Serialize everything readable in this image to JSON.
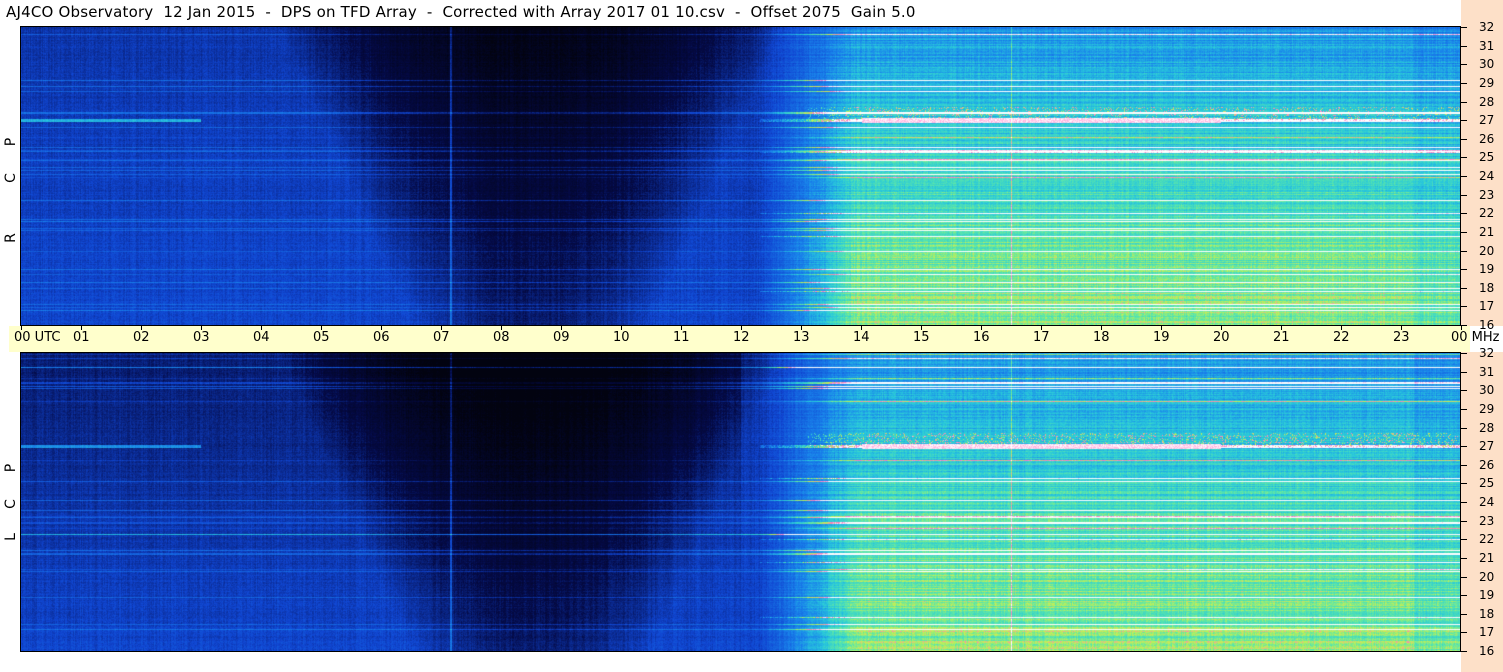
{
  "title": "AJ4CO Observatory  12 Jan 2015  -  DPS on TFD Array  -  Corrected with Array 2017 01 10.csv  -  Offset 2075  Gain 5.0",
  "chart_data": {
    "type": "heatmap",
    "title": "AJ4CO Observatory  12 Jan 2015  -  DPS on TFD Array  -  Corrected with Array 2017 01 10.csv  -  Offset 2075  Gain 5.0",
    "x_ticks": [
      "00 UTC",
      "01",
      "02",
      "03",
      "04",
      "05",
      "06",
      "07",
      "08",
      "09",
      "10",
      "11",
      "12",
      "13",
      "14",
      "15",
      "16",
      "17",
      "18",
      "19",
      "20",
      "21",
      "22",
      "23",
      "00 MHz"
    ],
    "xlim_hours": [
      0,
      24
    ],
    "ylim_mhz": [
      16,
      32
    ],
    "y_ticks": [
      "32",
      "31",
      "30",
      "29",
      "28",
      "27",
      "26",
      "25",
      "24",
      "23",
      "22",
      "21",
      "20",
      "19",
      "18",
      "17",
      "16"
    ],
    "panels": [
      {
        "name": "R C P",
        "labels": [
          "R",
          "C",
          "P"
        ]
      },
      {
        "name": "L C P",
        "labels": [
          "L",
          "C",
          "P"
        ]
      }
    ],
    "features": {
      "dark_region_hours": [
        5.5,
        11.5
      ],
      "bright_region_hours": [
        13,
        24
      ],
      "strong_band_mhz": 27,
      "vertical_line_hours": [
        7.15,
        16.5
      ]
    },
    "colors": {
      "low": "#000010",
      "mid": "#1450e0",
      "high": "#40e0c0",
      "peak": "#ffffff",
      "hot": "#ff40c0",
      "axis_bg": "#ffffcc",
      "right_axis_bg": "#fde0c8"
    }
  }
}
